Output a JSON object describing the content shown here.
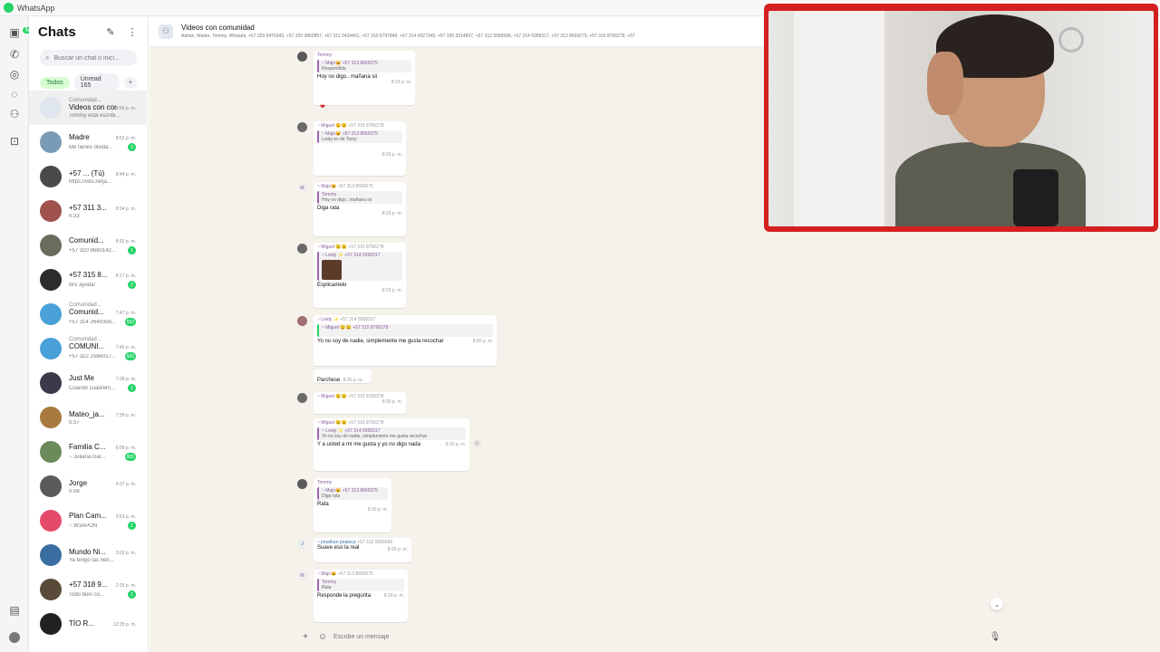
{
  "window": {
    "title": "WhatsApp"
  },
  "rail": {
    "badge": "Más"
  },
  "chatlist": {
    "title": "Chats",
    "search_placeholder": "Buscar un chat o inici...",
    "filters": [
      {
        "label": "Todos"
      },
      {
        "label": "Unread 165"
      },
      {
        "label": "+"
      }
    ],
    "chats": [
      {
        "sub": "Comunidad...",
        "name": "Videos con comu...",
        "time": "8:56 p. m.",
        "preview": "Tommy está escribi...",
        "unread": "",
        "color": "#dfe6ee"
      },
      {
        "sub": "",
        "name": "Madre",
        "time": "8:52 p. m.",
        "preview": "Me tienes olvida...",
        "unread": "3",
        "color": "#7a9bb5"
      },
      {
        "sub": "",
        "name": "+57 ... (Tú)",
        "time": "8:44 p. m.",
        "preview": "https://vdo.ninja...",
        "unread": "",
        "color": "#4a4a4a"
      },
      {
        "sub": "",
        "name": "+57 311 3...",
        "time": "8:34 p. m.",
        "preview": "0:33",
        "unread": "",
        "color": "#a0524d"
      },
      {
        "sub": "",
        "name": "Comunid...",
        "time": "8:52 p. m.",
        "preview": "+57 320 9680142...",
        "unread": "1",
        "color": "#6b6b5e"
      },
      {
        "sub": "",
        "name": "+57 315 8...",
        "time": "8:17 p. m.",
        "preview": "Bro ayudar",
        "unread": "2",
        "color": "#2c2c2c"
      },
      {
        "sub": "Comunidad...",
        "name": "Comunid...",
        "time": "7:47 p. m.",
        "preview": "+57 314 2649358...",
        "unread": "553",
        "color": "#4aa0d8"
      },
      {
        "sub": "Comunidad...",
        "name": "COMUNI...",
        "time": "7:46 p. m.",
        "preview": "+57 322 2584017...",
        "unread": "600",
        "color": "#4aa0d8"
      },
      {
        "sub": "",
        "name": "Just Me",
        "time": "7:38 p. m.",
        "preview": "Cuando cuadrem...",
        "unread": "1",
        "color": "#3a3a4a"
      },
      {
        "sub": "",
        "name": "Mateo_ja...",
        "time": "7:35 p. m.",
        "preview": "0:37",
        "unread": "",
        "color": "#a87a3f"
      },
      {
        "sub": "",
        "name": "Familia C...",
        "time": "6:06 p. m.",
        "preview": "~ Juliana Gar...",
        "unread": "805",
        "color": "#6c8b5a"
      },
      {
        "sub": "",
        "name": "Jorge",
        "time": "4:37 p. m.",
        "preview": "0:08",
        "unread": "",
        "color": "#5b5b5b"
      },
      {
        "sub": "",
        "name": "Plan Cam...",
        "time": "3:53 p. m.",
        "preview": "~ W3APON",
        "unread": "1",
        "color": "#e64a6b"
      },
      {
        "sub": "",
        "name": "Mundo Ni...",
        "time": "3:02 p. m.",
        "preview": "Ya tengo las nen...",
        "unread": "",
        "color": "#3b6ea0"
      },
      {
        "sub": "",
        "name": "+57 318 9...",
        "time": "2:15 p. m.",
        "preview": "Todo bien co...",
        "unread": "2",
        "color": "#5a4a3a"
      },
      {
        "sub": "",
        "name": "TÍO R...",
        "time": "12:35 p. m.",
        "preview": "",
        "unread": "",
        "color": "#222222"
      }
    ]
  },
  "conversation": {
    "title": "Videos con comunidad",
    "members": "Adrian, Madre, Tommy, Whatafa, +57 320 6476343, +57 320 3860857, +57 311 3434401, +57 310 6797849, +57 314 4327349, +57 320 3514837, +57 312 5056996, +57 314 5958317, +57 313 8669275, +57 315 8766278, +57",
    "composer_placeholder": "Escribe un mensaje",
    "messages": [
      {
        "avatar": "",
        "sender": "Tommy",
        "phone": "",
        "quote_sender": "~ Majo😺",
        "quote_phone": "+57 313 8669275",
        "quote_text": "Respondida",
        "text": "Hoy no digo.. mañana sii",
        "time": "8:29 p. m.",
        "reaction": "❤"
      },
      {
        "avatar": "",
        "sender": "~ Miguel 😉😉",
        "phone": "+57 315 8766278",
        "quote_sender": "~ Majo😺",
        "quote_phone": "+57 313 8669275",
        "quote_text": "Leidy es de Tomy",
        "text": "",
        "time": "8:29 p. m."
      },
      {
        "avatar": "M",
        "sender": "~ Majo😺",
        "phone": "+57 313 8669275",
        "quote_sender": "Tommy",
        "quote_phone": "",
        "quote_text": "Hoy no digo.. mañana sii",
        "text": "Diga rata",
        "time": "8:29 p. m."
      },
      {
        "avatar": "",
        "sender": "~ Miguel 😉😉",
        "phone": "+57 315 8766278",
        "quote_sender": "~ Leidy ✨",
        "quote_phone": "+57 314 5958317",
        "quote_text": "",
        "text": "Esplicamelo",
        "time": "8:29 p. m."
      },
      {
        "avatar": "",
        "sender": "~ Leidy ✨",
        "phone": "+57 314 5958317",
        "quote_sender": "~ Miguel 😉😉",
        "quote_phone": "+57 315 8766278",
        "quote_text": "",
        "text": "Yo no soy de nadie, simplemente me gusta recochar",
        "time": "8:30 p. m.",
        "text2": "Parchese",
        "time2": "8:30 p. m."
      },
      {
        "avatar": "",
        "sender": "~ Miguel 😉😉",
        "phone": "+57 315 8766278",
        "quote_sender": "",
        "quote_phone": "",
        "quote_text": "",
        "text": "",
        "time": "8:30 p. m."
      },
      {
        "avatar": "",
        "sender": "~ Miguel 😉😉",
        "phone": "+57 315 8766278",
        "quote_sender": "~ Leidy ✨",
        "quote_phone": "+57 314 5958317",
        "quote_text": "Yo no soy de nadie, simplemente me gusta recochar",
        "text": "Y a usted a mí me gusta y yo no digo nada",
        "time": "8:30 p. m."
      },
      {
        "avatar": "",
        "sender": "Tommy",
        "phone": "",
        "quote_sender": "~ Majo😺",
        "quote_phone": "+57 313 8669275",
        "quote_text": "Diga rata",
        "text": "Rata",
        "time": "8:30 p. m."
      },
      {
        "avatar": "J",
        "sender": "~ jonathan pirateca",
        "phone": "+57 312 5056996",
        "quote_sender": "",
        "quote_phone": "",
        "quote_text": "",
        "text": "Suave eso la real",
        "time": "8:30 p. m."
      },
      {
        "avatar": "M",
        "sender": "~ Majo😺",
        "phone": "+57 313 8669275",
        "quote_sender": "Tommy",
        "quote_phone": "",
        "quote_text": "Rata",
        "text": "Responde la pregunta",
        "time": "8:30 p. m."
      }
    ]
  }
}
